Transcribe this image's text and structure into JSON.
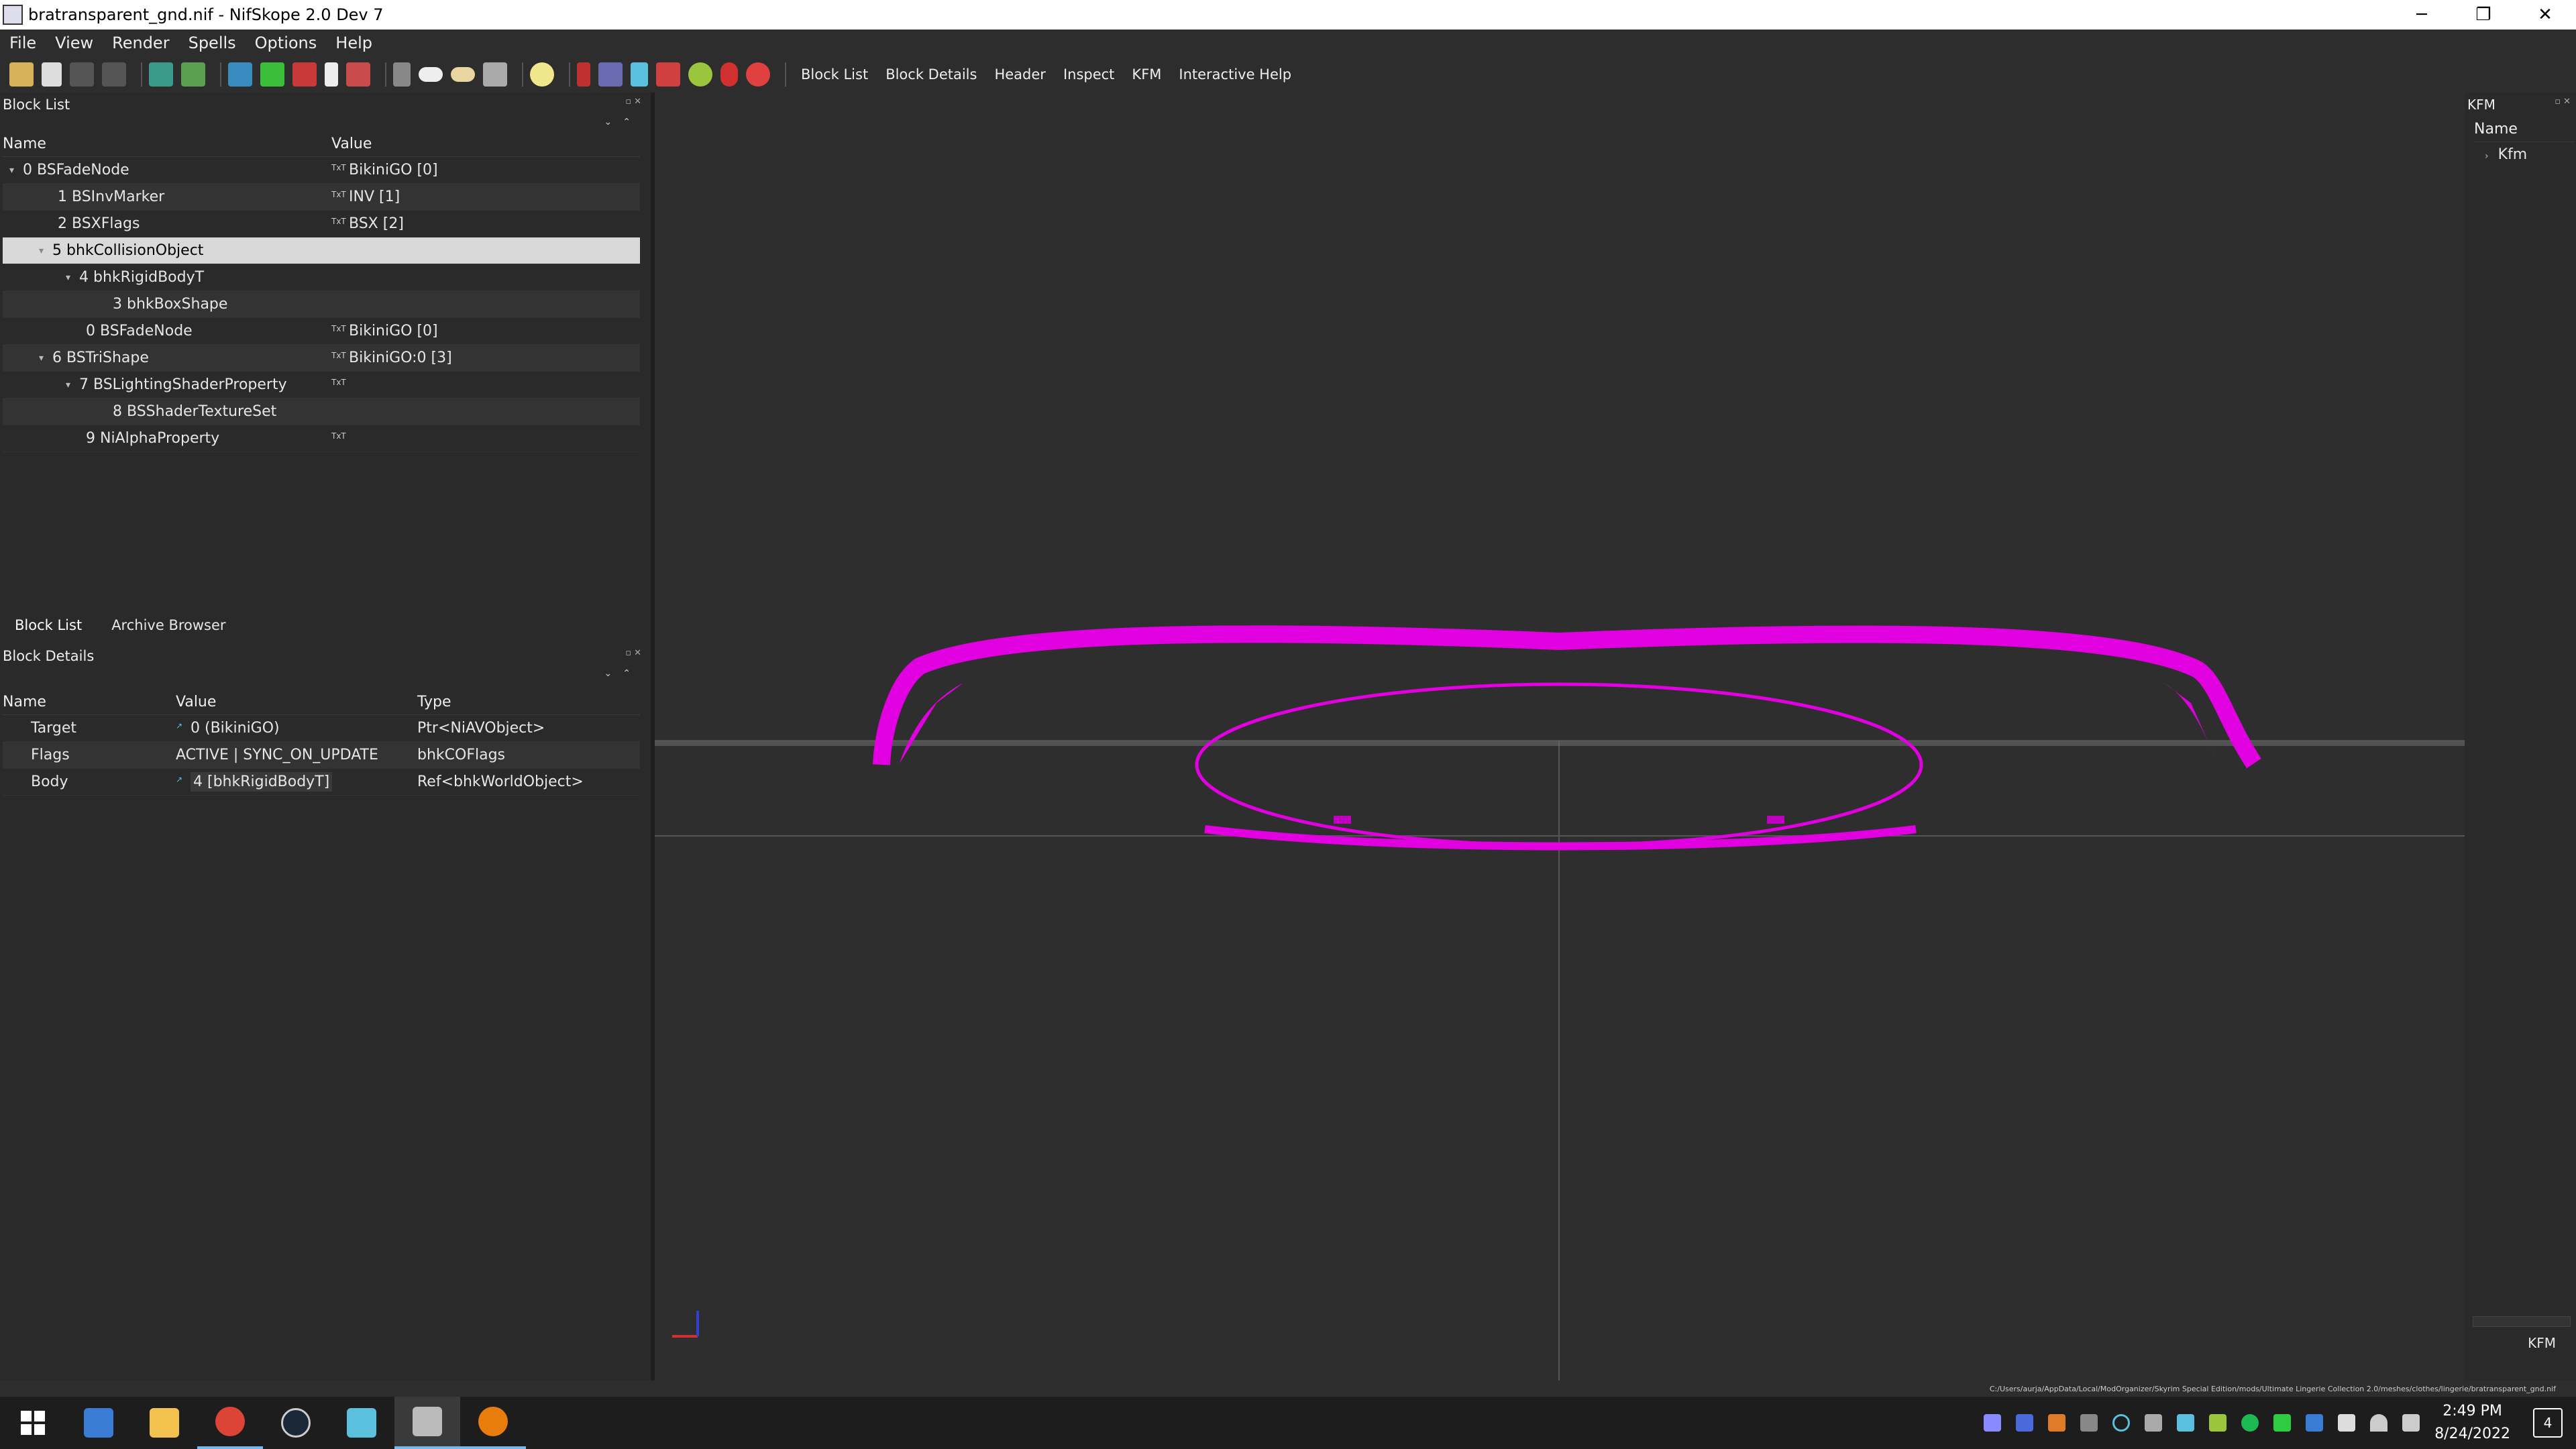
{
  "window": {
    "title": "bratransparent_gnd.nif - NifSkope 2.0 Dev 7",
    "minimize": "─",
    "maximize": "❐",
    "close": "✕"
  },
  "menu": [
    "File",
    "View",
    "Render",
    "Spells",
    "Options",
    "Help"
  ],
  "toolbar_links": [
    "Block List",
    "Block Details",
    "Header",
    "Inspect",
    "KFM",
    "Interactive Help"
  ],
  "block_list": {
    "title": "Block List",
    "col_name": "Name",
    "col_value": "Value",
    "rows": [
      {
        "name": "0 BSFadeNode",
        "value": "BikiniGO [0]"
      },
      {
        "name": "1 BSInvMarker",
        "value": "INV [1]"
      },
      {
        "name": "2 BSXFlags",
        "value": "BSX [2]"
      },
      {
        "name": "5 bhkCollisionObject",
        "value": ""
      },
      {
        "name": "4 bhkRigidBodyT",
        "value": ""
      },
      {
        "name": "3 bhkBoxShape",
        "value": ""
      },
      {
        "name": "0 BSFadeNode",
        "value": "BikiniGO [0]"
      },
      {
        "name": "6 BSTriShape",
        "value": "BikiniGO:0 [3]"
      },
      {
        "name": "7 BSLightingShaderProperty",
        "value": ""
      },
      {
        "name": "8 BSShaderTextureSet",
        "value": ""
      },
      {
        "name": "9 NiAlphaProperty",
        "value": ""
      }
    ],
    "tabs": [
      "Block List",
      "Archive Browser"
    ]
  },
  "block_details": {
    "title": "Block Details",
    "col_name": "Name",
    "col_value": "Value",
    "col_type": "Type",
    "rows": [
      {
        "name": "Target",
        "value": "0 (BikiniGO)",
        "type": "Ptr<NiAVObject>"
      },
      {
        "name": "Flags",
        "value": "ACTIVE | SYNC_ON_UPDATE",
        "type": "bhkCOFlags"
      },
      {
        "name": "Body",
        "value": "4 [bhkRigidBodyT]",
        "type": "Ref<bhkWorldObject>"
      }
    ]
  },
  "kfm": {
    "title": "KFM",
    "col_name": "Name",
    "item": "Kfm",
    "tab": "KFM"
  },
  "status_path": "C:/Users/aurja/AppData/Local/ModOrganizer/Skyrim Special Edition/mods/Ultimate Lingerie Collection 2.0/meshes/clothes/lingerie/bratransparent_gnd.nif",
  "taskbar": {
    "time": "2:49 PM",
    "date": "8/24/2022",
    "notifications": "4"
  },
  "colors": {
    "mesh": "#e000e0",
    "selection": "#d9d9d9",
    "background": "#2e2e2e"
  }
}
